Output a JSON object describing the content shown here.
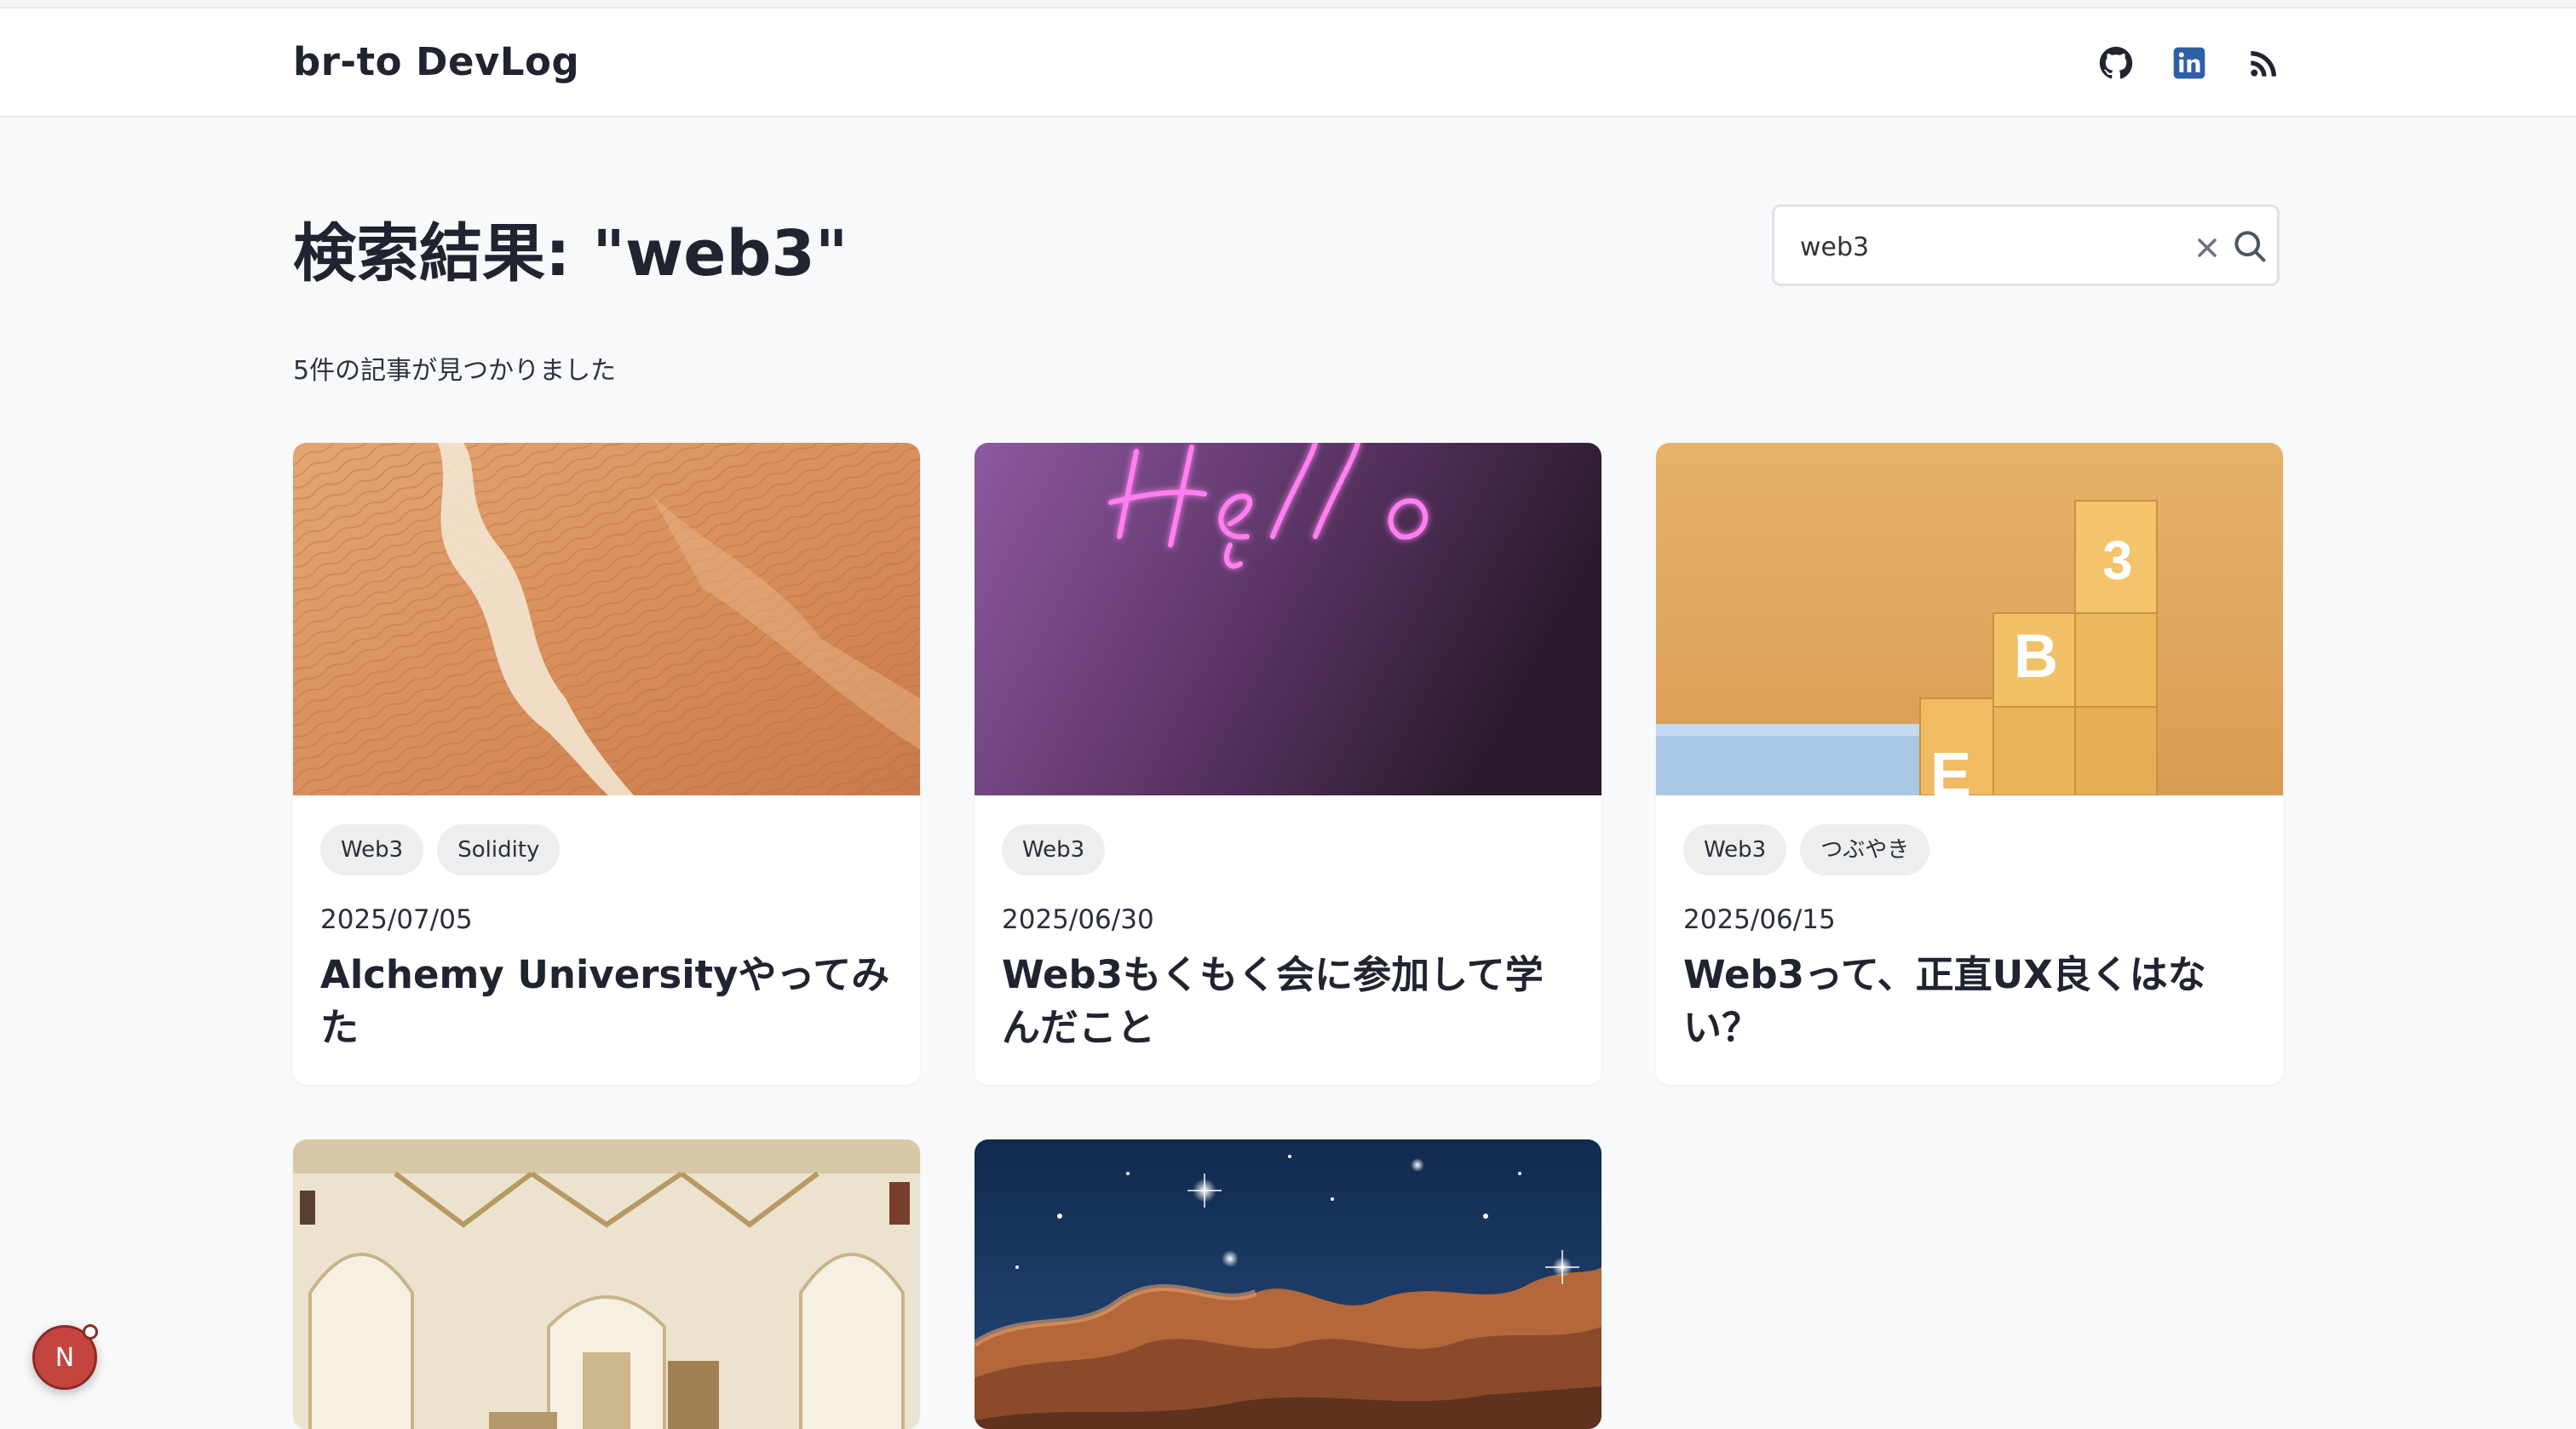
{
  "header": {
    "brand": "br-to DevLog",
    "icons": [
      "github-icon",
      "linkedin-icon",
      "rss-icon"
    ]
  },
  "page": {
    "title": "検索結果: \"web3\"",
    "result_count": "5件の記事が見つかりました"
  },
  "search": {
    "value": "web3",
    "placeholder": ""
  },
  "cards": [
    {
      "tags": [
        "Web3",
        "Solidity"
      ],
      "date": "2025/07/05",
      "title": "Alchemy Universityやってみた",
      "image": "desert-aerial"
    },
    {
      "tags": [
        "Web3"
      ],
      "date": "2025/06/30",
      "title": "Web3もくもく会に参加して学んだこと",
      "image": "neon-hello"
    },
    {
      "tags": [
        "Web3",
        "つぶやき"
      ],
      "date": "2025/06/15",
      "title": "Web3って、正直UX良くはない？",
      "image": "web3-blocks"
    },
    {
      "image": "church-interior"
    },
    {
      "image": "nebula"
    }
  ],
  "colors": {
    "background": "#f8f9fa",
    "text": "#1f2430",
    "tag_bg": "#eceef0",
    "linkedin": "#2f5fa7",
    "devtools_badge": "#c4453f"
  },
  "devtools": {
    "label": "N"
  }
}
